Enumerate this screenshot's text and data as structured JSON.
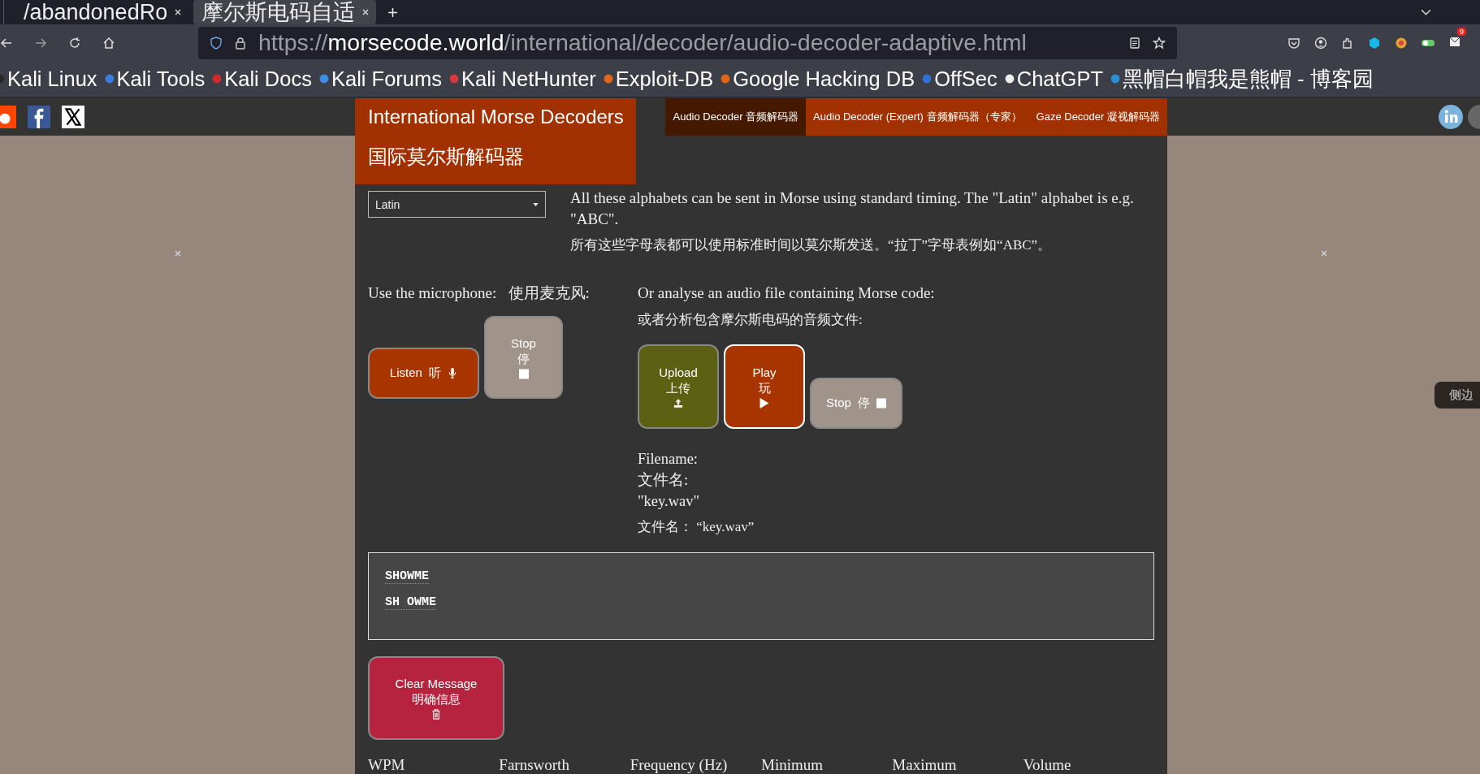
{
  "browser": {
    "tabs": [
      {
        "title": "/abandonedRo",
        "selected": false
      },
      {
        "title": "摩尔斯电码自适",
        "selected": true
      }
    ],
    "url": {
      "scheme": "https://",
      "host": "morsecode.world",
      "path": "/international/decoder/audio-decoder-adaptive.html"
    },
    "notification_badge": "9",
    "bookmarks": [
      {
        "label": "Kali Linux",
        "color": "#2a2a2a"
      },
      {
        "label": "Kali Tools",
        "color": "#3b7ddd"
      },
      {
        "label": "Kali Docs",
        "color": "#d02b2b"
      },
      {
        "label": "Kali Forums",
        "color": "#3c8ee6"
      },
      {
        "label": "Kali NetHunter",
        "color": "#d63a3a"
      },
      {
        "label": "Exploit-DB",
        "color": "#e0661c"
      },
      {
        "label": "Google Hacking DB",
        "color": "#e0661c"
      },
      {
        "label": "OffSec",
        "color": "#2f6fd6"
      },
      {
        "label": "ChatGPT",
        "color": "#eeeeee"
      },
      {
        "label": "黑帽白帽我是熊帽 - 博客园",
        "color": "#2b8fd8"
      }
    ]
  },
  "site": {
    "title_lines": [
      "International Morse Decoders",
      "国际莫尔斯解码器"
    ],
    "nav": [
      {
        "label": "Audio Decoder  音频解码器",
        "selected": true
      },
      {
        "label": "Audio Decoder (Expert)  音频解码器（专家）",
        "selected": false
      },
      {
        "label": "Gaze Decoder  凝视解码器",
        "selected": false
      }
    ],
    "sidebar_tab": "侧边"
  },
  "alphabet": {
    "value": "Latin",
    "note_en": "All these alphabets can be sent in Morse using standard timing. The \"Latin\" alphabet is e.g. \"ABC\".",
    "note_zh": "所有这些字母表都可以使用标准时间以莫尔斯发送。“拉丁”字母表例如“ABC”。"
  },
  "microphone": {
    "label": "Use the microphone:   使用麦克风:",
    "buttons": [
      {
        "kind": "listen",
        "lines": [
          "Listen  听"
        ]
      },
      {
        "kind": "stop",
        "lines": [
          "Stop",
          "停"
        ]
      }
    ]
  },
  "file": {
    "label_en": "Or analyse an audio file containing Morse code:",
    "label_zh": "或者分析包含摩尔斯电码的音频文件:",
    "buttons": [
      {
        "kind": "upload",
        "lines": [
          "Upload",
          "上传"
        ],
        "focused": false
      },
      {
        "kind": "play",
        "lines": [
          "Play",
          "玩"
        ],
        "focused": true
      },
      {
        "kind": "stop",
        "lines": [
          "Stop  停"
        ],
        "focused": false
      }
    ],
    "filename_lines": [
      "Filename:",
      "文件名:",
      "\"key.wav\""
    ],
    "filename_zh": "文件名：  “key.wav”"
  },
  "output": [
    "SHOWME",
    "SH OWME"
  ],
  "clear_button": {
    "kind": "clear",
    "lines": [
      "Clear Message",
      "明确信息"
    ]
  },
  "settings_labels": [
    "WPM",
    "Farnsworth",
    "Frequency (Hz)",
    "Minimum",
    "Maximum",
    "Volume"
  ]
}
